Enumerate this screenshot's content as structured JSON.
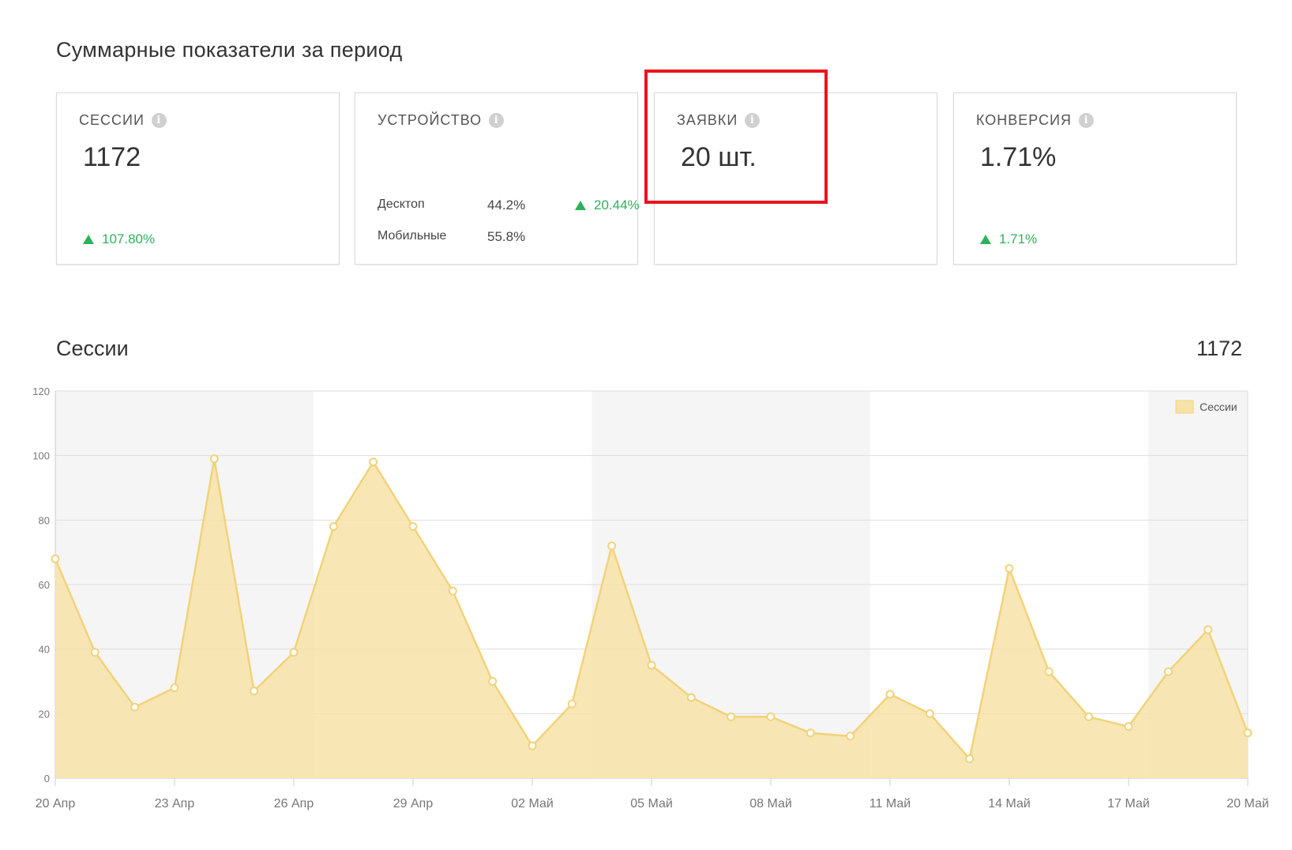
{
  "summary": {
    "title": "Суммарные показатели за период",
    "cards": [
      {
        "label": "СЕССИИ",
        "value": "1172",
        "delta": "107.80%"
      },
      {
        "label": "УСТРОЙСТВО",
        "devices": [
          {
            "name": "Десктоп",
            "value": "44.2%",
            "delta": "20.44%"
          },
          {
            "name": "Мобильные",
            "value": "55.8%",
            "delta": ""
          }
        ]
      },
      {
        "label": "ЗАЯВКИ",
        "value": "20 шт.",
        "delta": ""
      },
      {
        "label": "КОНВЕРСИЯ",
        "value": "1.71%",
        "delta": "1.71%"
      }
    ]
  },
  "sessions_chart": {
    "title": "Сессии",
    "total": "1172"
  },
  "colors": {
    "accent_line": "#f2d27a",
    "accent_fill": "#f7e3a8",
    "positive": "#2db25a",
    "highlight": "#e8141e"
  },
  "chart_data": {
    "type": "area",
    "title": "Сессии",
    "xlabel": "",
    "ylabel": "",
    "ylim": [
      0,
      120
    ],
    "yticks": [
      0,
      20,
      40,
      60,
      80,
      100,
      120
    ],
    "x": [
      "20 Апр",
      "21 Апр",
      "22 Апр",
      "23 Апр",
      "24 Апр",
      "25 Апр",
      "26 Апр",
      "27 Апр",
      "28 Апр",
      "29 Апр",
      "30 Апр",
      "01 Май",
      "02 Май",
      "03 Май",
      "04 Май",
      "05 Май",
      "06 Май",
      "07 Май",
      "08 Май",
      "09 Май",
      "10 Май",
      "11 Май",
      "12 Май",
      "13 Май",
      "14 Май",
      "15 Май",
      "16 Май",
      "17 Май",
      "18 Май",
      "19 Май",
      "20 Май"
    ],
    "xtick_labels": [
      "20 Апр",
      "23 Апр",
      "26 Апр",
      "29 Апр",
      "02 Май",
      "05 Май",
      "08 Май",
      "11 Май",
      "14 Май",
      "17 Май",
      "20 Май"
    ],
    "series": [
      {
        "name": "Сессии",
        "values": [
          68,
          39,
          22,
          28,
          99,
          27,
          39,
          78,
          98,
          78,
          58,
          30,
          10,
          23,
          72,
          35,
          25,
          19,
          19,
          14,
          13,
          26,
          20,
          6,
          65,
          33,
          19,
          16,
          33,
          46,
          14
        ]
      }
    ],
    "legend": "top-right",
    "grid": true
  }
}
